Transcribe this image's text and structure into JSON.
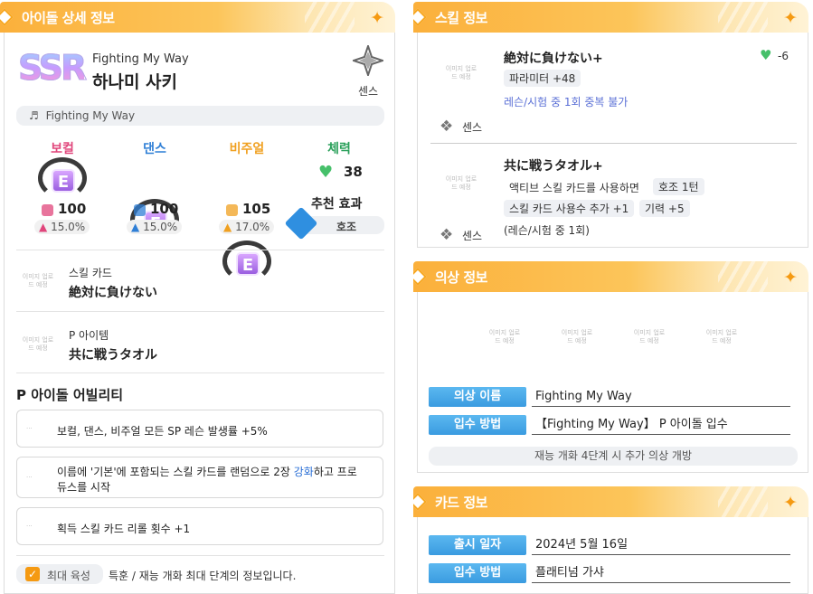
{
  "left": {
    "header": "아이돌 상세 정보",
    "card_subtitle": "Fighting My Way",
    "idol_name": "하나미 사키",
    "rarity": "SSR",
    "type_label": "센스",
    "song": "Fighting My Way",
    "stats": [
      {
        "name": "보컬",
        "color": "#e0457b",
        "grade": "E",
        "value": "100",
        "pct": "15.0%"
      },
      {
        "name": "댄스",
        "color": "#2f7fd6",
        "grade": "E",
        "value": "100",
        "pct": "15.0%"
      },
      {
        "name": "비주얼",
        "color": "#f0a020",
        "grade": "E",
        "value": "105",
        "pct": "17.0%"
      }
    ],
    "stamina_label": "체력",
    "stamina_value": "38",
    "recommend_label": "추천 효과",
    "recommend_value": "호조",
    "skill_card_label": "스킬 카드",
    "skill_card_name": "絶対に負けない",
    "p_item_label": "P 아이템",
    "p_item_name": "共に戦うタオル",
    "ability_title": "P 아이돌 어빌리티",
    "abilities": [
      "보컬, 댄스, 비주얼 모든 SP 레슨 발생률 +5%",
      "이름에 '기본'에 포함되는 스킬 카드를 랜덤으로 2장 ",
      "획득 스킬 카드 리롤 횟수 +1"
    ],
    "ability2_highlight": "강화",
    "ability2_suffix": "하고 프로",
    "ability2_line2": "듀스를 시작",
    "max_train_label": "최대 육성",
    "max_train_desc": "특훈 / 재능 개화 최대 단계의 정보입니다.",
    "placeholder": "이미지 업로드 예정"
  },
  "skill": {
    "header": "스킬 정보",
    "items": [
      {
        "name": "絶対に負けない+",
        "cost": "-6",
        "type": "센스"
      },
      {
        "name": "共に戦うタオル+",
        "type": "센스"
      }
    ],
    "s1_chip": "파라미터 +48",
    "s1_note": "레슨/시험 중 1회 중복 불가",
    "s2_line1": "액티브 스킬 카드를 사용하면",
    "s2_chip1": "호조 1턴",
    "s2_chip2": "스킬 카드 사용수 추가 +1",
    "s2_chip3": "기력 +5",
    "s2_note": "(레슨/시험 중 1회)"
  },
  "costume": {
    "header": "의상 정보",
    "name_label": "의상 이름",
    "name_value": "Fighting My Way",
    "get_label": "입수 방법",
    "get_value": "【Fighting My Way】 P 아이돌 입수",
    "note": "재능 개화 4단계 시 추가 의상 개방"
  },
  "card": {
    "header": "카드 정보",
    "release_label": "출시 일자",
    "release_value": "2024년 5월 16일",
    "get_label": "입수 방법",
    "get_value": "플래티넘 가샤"
  }
}
